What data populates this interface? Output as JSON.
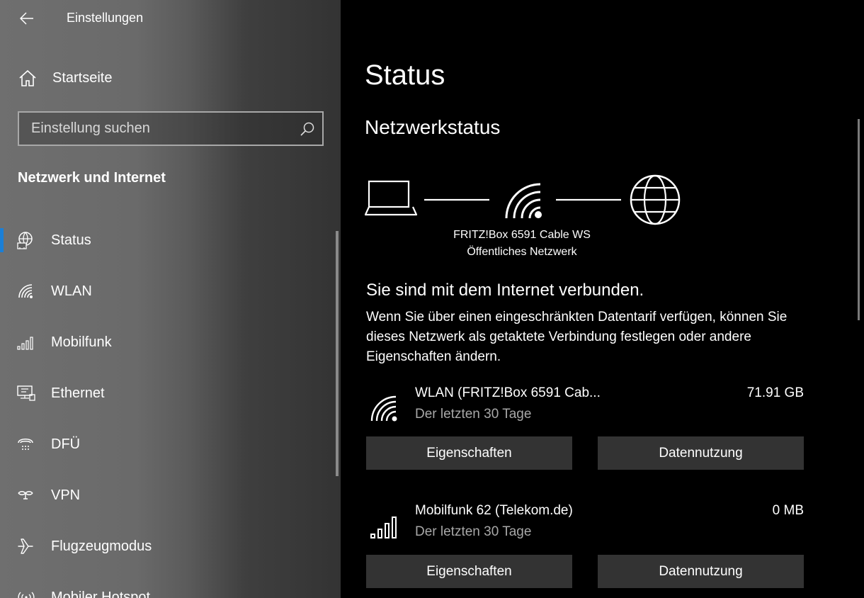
{
  "app": {
    "title": "Einstellungen"
  },
  "sidebar": {
    "home_label": "Startseite",
    "search_placeholder": "Einstellung suchen",
    "section_title": "Netzwerk und Internet",
    "items": [
      {
        "label": "Status",
        "icon": "globe-status-icon",
        "active": true
      },
      {
        "label": "WLAN",
        "icon": "wifi-icon"
      },
      {
        "label": "Mobilfunk",
        "icon": "cellular-icon"
      },
      {
        "label": "Ethernet",
        "icon": "ethernet-icon"
      },
      {
        "label": "DFÜ",
        "icon": "dialup-icon"
      },
      {
        "label": "VPN",
        "icon": "vpn-icon"
      },
      {
        "label": "Flugzeugmodus",
        "icon": "airplane-icon"
      },
      {
        "label": "Mobiler Hotspot",
        "icon": "hotspot-icon"
      }
    ]
  },
  "main": {
    "title": "Status",
    "subtitle": "Netzwerkstatus",
    "network_name": "FRITZ!Box 6591 Cable WS",
    "network_type": "Öffentliches Netzwerk",
    "connected_text": "Sie sind mit dem Internet verbunden.",
    "description": "Wenn Sie über einen eingeschränkten Datentarif verfügen, können Sie dieses Netzwerk als getaktete Verbindung festlegen oder andere Eigenschaften ändern.",
    "connections": [
      {
        "name": "WLAN (FRITZ!Box 6591 Cab...",
        "period": "Der letzten 30 Tage",
        "usage": "71.91 GB",
        "icon": "wifi-icon",
        "properties_label": "Eigenschaften",
        "data_usage_label": "Datennutzung"
      },
      {
        "name": "Mobilfunk 62 (Telekom.de)",
        "period": "Der letzten 30 Tage",
        "usage": "0 MB",
        "icon": "cellular-icon",
        "properties_label": "Eigenschaften",
        "data_usage_label": "Datennutzung"
      }
    ]
  },
  "colors": {
    "accent": "#1a7fd7",
    "button_bg": "#333333",
    "secondary_text": "#a8a8a8"
  }
}
